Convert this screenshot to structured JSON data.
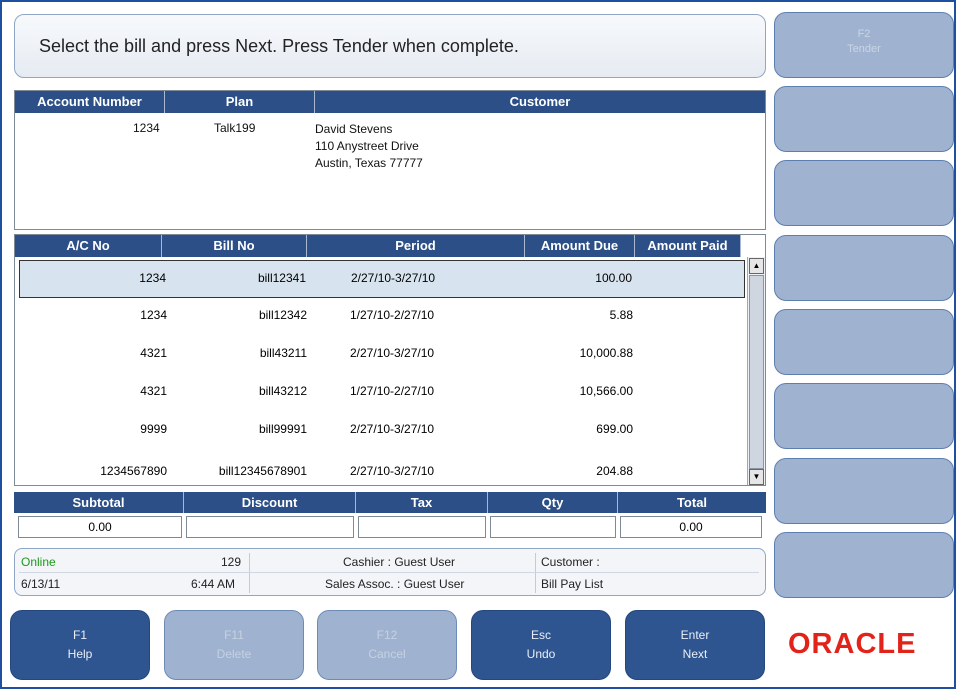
{
  "prompt": "Select the bill and press Next. Press Tender when complete.",
  "side_buttons": [
    {
      "key": "F2",
      "label": "Tender"
    },
    {
      "key": "",
      "label": ""
    },
    {
      "key": "",
      "label": ""
    },
    {
      "key": "",
      "label": ""
    },
    {
      "key": "",
      "label": ""
    },
    {
      "key": "",
      "label": ""
    },
    {
      "key": "",
      "label": ""
    },
    {
      "key": "",
      "label": ""
    }
  ],
  "customer": {
    "headers": {
      "account": "Account Number",
      "plan": "Plan",
      "customer": "Customer"
    },
    "account_number": "1234",
    "plan": "Talk199",
    "name": "David Stevens",
    "address1": "110 Anystreet Drive",
    "address2": "Austin, Texas 77777"
  },
  "bills": {
    "headers": {
      "ac_no": "A/C No",
      "bill_no": "Bill No",
      "period": "Period",
      "amount_due": "Amount Due",
      "amount_paid": "Amount Paid"
    },
    "rows": [
      {
        "ac_no": "1234",
        "bill_no": "bill12341",
        "period": "2/27/10-3/27/10",
        "amount_due": "100.00",
        "amount_paid": ""
      },
      {
        "ac_no": "1234",
        "bill_no": "bill12342",
        "period": "1/27/10-2/27/10",
        "amount_due": "5.88",
        "amount_paid": ""
      },
      {
        "ac_no": "4321",
        "bill_no": "bill43211",
        "period": "2/27/10-3/27/10",
        "amount_due": "10,000.88",
        "amount_paid": ""
      },
      {
        "ac_no": "4321",
        "bill_no": "bill43212",
        "period": "1/27/10-2/27/10",
        "amount_due": "10,566.00",
        "amount_paid": ""
      },
      {
        "ac_no": "9999",
        "bill_no": "bill99991",
        "period": "2/27/10-3/27/10",
        "amount_due": "699.00",
        "amount_paid": ""
      },
      {
        "ac_no": "1234567890",
        "bill_no": "bill12345678901",
        "period": "2/27/10-3/27/10",
        "amount_due": "204.88",
        "amount_paid": ""
      }
    ]
  },
  "totals": {
    "headers": {
      "subtotal": "Subtotal",
      "discount": "Discount",
      "tax": "Tax",
      "qty": "Qty",
      "total": "Total"
    },
    "subtotal": "0.00",
    "discount": "",
    "tax": "",
    "qty": "",
    "total": "0.00"
  },
  "status": {
    "online": "Online",
    "register": "129",
    "cashier": "Cashier : Guest User",
    "customer": "Customer :",
    "date": "6/13/11",
    "time": "6:44 AM",
    "sales_assoc": "Sales Assoc. : Guest User",
    "screen": "Bill Pay List"
  },
  "bottom_buttons": [
    {
      "key": "F1",
      "label": "Help",
      "enabled": true
    },
    {
      "key": "F11",
      "label": "Delete",
      "enabled": false
    },
    {
      "key": "F12",
      "label": "Cancel",
      "enabled": false
    },
    {
      "key": "Esc",
      "label": "Undo",
      "enabled": true
    },
    {
      "key": "Enter",
      "label": "Next",
      "enabled": true
    }
  ],
  "logo": "ORACLE",
  "colors": {
    "header_bg": "#2b4f86",
    "button_active": "#2e558f",
    "button_disabled": "#9fb3d0",
    "online_green": "#1a9a1a",
    "logo_red": "#e2231a"
  }
}
